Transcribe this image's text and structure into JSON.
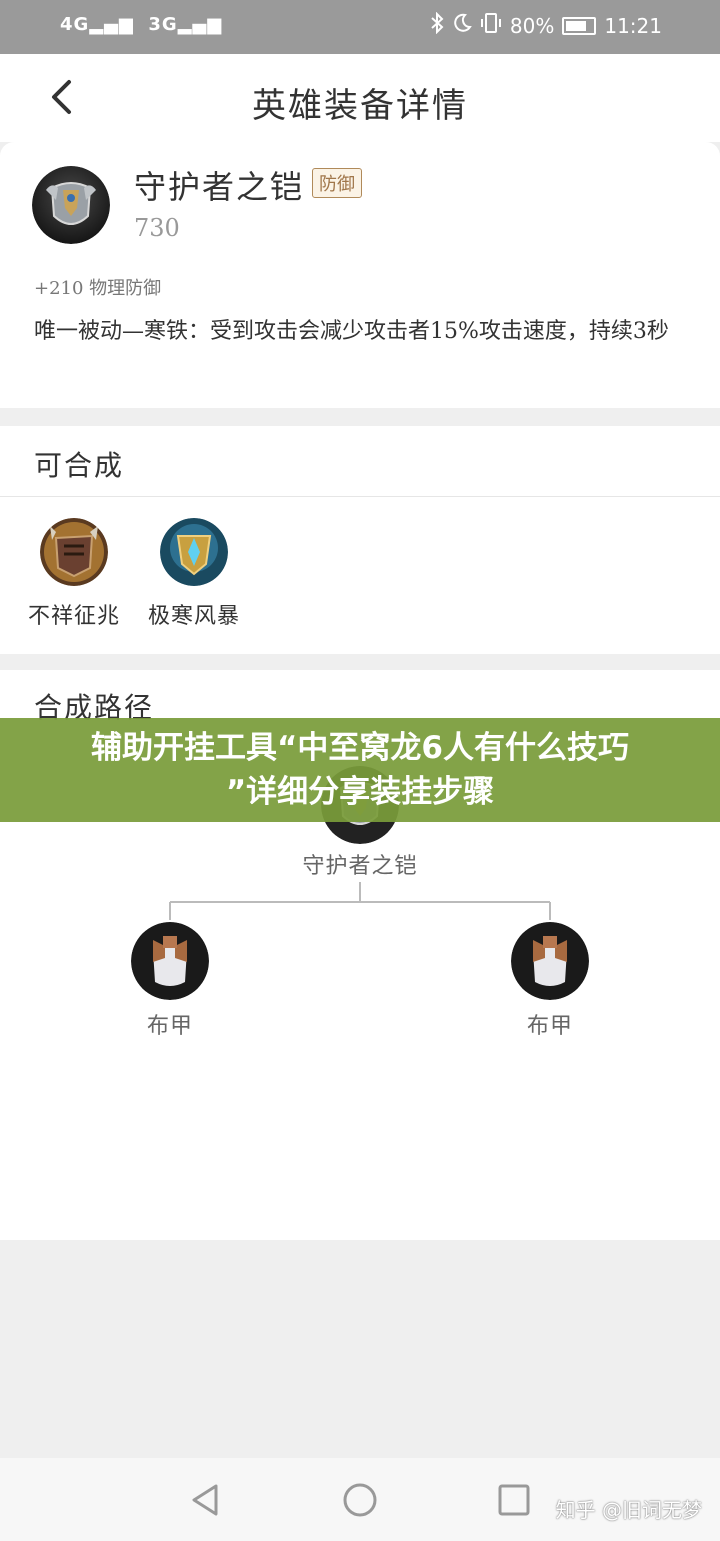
{
  "status_bar": {
    "signal_1": "4G",
    "signal_2": "3G",
    "battery": "80%",
    "time": "11:21"
  },
  "header": {
    "title": "英雄装备详情"
  },
  "item": {
    "name": "守护者之铠",
    "tag": "防御",
    "price": "730",
    "stat": "+210 物理防御",
    "description": "唯一被动—寒铁：受到攻击会减少攻击者15%攻击速度，持续3秒"
  },
  "synthesis": {
    "heading": "可合成",
    "items": [
      {
        "label": "不祥征兆"
      },
      {
        "label": "极寒风暴"
      }
    ]
  },
  "path": {
    "heading": "合成路径",
    "root_label": "守护者之铠",
    "children": [
      {
        "label": "布甲"
      },
      {
        "label": "布甲"
      }
    ]
  },
  "banner": {
    "line1": "辅助开挂工具“中至窝龙6人有什么技巧",
    "line2": "”详细分享装挂步骤"
  },
  "watermark": "知乎 @旧词无梦",
  "colors": {
    "status_bar": "#9a9a9a",
    "banner": "#7a9c3a",
    "tag_border": "#b08a5a"
  }
}
